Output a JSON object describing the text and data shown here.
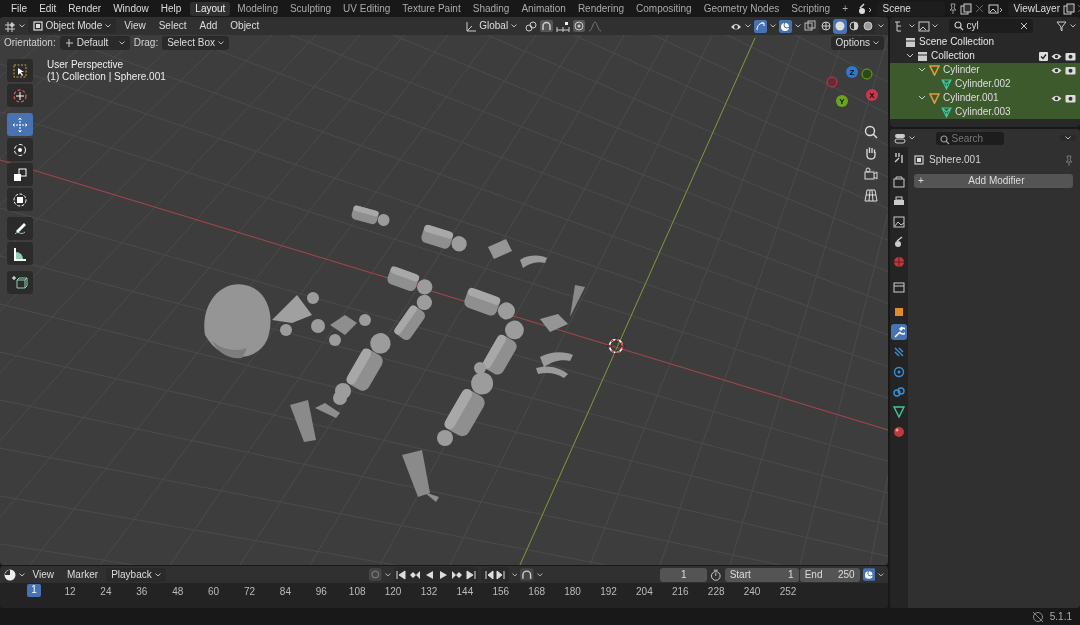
{
  "top_menu": [
    "File",
    "Edit",
    "Render",
    "Window",
    "Help"
  ],
  "workspaces": [
    {
      "label": "Layout",
      "selected": true
    },
    {
      "label": "Modeling",
      "selected": false
    },
    {
      "label": "Sculpting",
      "selected": false
    },
    {
      "label": "UV Editing",
      "selected": false
    },
    {
      "label": "Texture Paint",
      "selected": false
    },
    {
      "label": "Shading",
      "selected": false
    },
    {
      "label": "Animation",
      "selected": false
    },
    {
      "label": "Rendering",
      "selected": false
    },
    {
      "label": "Compositing",
      "selected": false
    },
    {
      "label": "Geometry Nodes",
      "selected": false
    },
    {
      "label": "Scripting",
      "selected": false
    }
  ],
  "add_workspace": "+",
  "scene": "Scene",
  "view_layer": "ViewLayer",
  "viewport": {
    "mode": "Object Mode",
    "menus": [
      "View",
      "Select",
      "Add",
      "Object"
    ],
    "orientation": "Global",
    "shading_modes": [
      {
        "kind": "wireframe",
        "selected": false
      },
      {
        "kind": "solid",
        "selected": true
      },
      {
        "kind": "material",
        "selected": false
      },
      {
        "kind": "rendered",
        "selected": false
      }
    ],
    "tool_settings": {
      "orientation_label": "Orientation:",
      "orientation": "Default",
      "drag_label": "Drag:",
      "drag": "Select Box",
      "options": "Options"
    },
    "info": [
      "User Perspective",
      "(1) Collection | Sphere.001"
    ],
    "tools": [
      {
        "kind": "select",
        "selected": false
      },
      {
        "kind": "cursor",
        "selected": false
      },
      {
        "kind": "move",
        "selected": true
      },
      {
        "kind": "rotate",
        "selected": false
      },
      {
        "kind": "scale",
        "selected": false
      },
      {
        "kind": "transform",
        "selected": false
      },
      {
        "kind": "annotate",
        "selected": false
      },
      {
        "kind": "measure",
        "selected": false
      },
      {
        "kind": "add_cube",
        "selected": false
      }
    ],
    "gizmo_axes": [
      {
        "label": "X",
        "color": "#c8374b"
      },
      {
        "label": "Y",
        "color": "#6ba51c"
      },
      {
        "label": "Z",
        "color": "#2e78d2"
      }
    ]
  },
  "outliner": {
    "search": "cyl",
    "items": [
      {
        "label": "Scene Collection",
        "kind": "scene",
        "children": [
          {
            "label": "Collection",
            "kind": "collection",
            "expanded": true,
            "children": [
              {
                "label": "Cylinder",
                "kind": "object",
                "expanded": true,
                "selected": true,
                "children": [
                  {
                    "label": "Cylinder.002",
                    "kind": "mesh",
                    "selected": true
                  }
                ]
              },
              {
                "label": "Cylinder.001",
                "kind": "object",
                "expanded": true,
                "selected": true,
                "children": [
                  {
                    "label": "Cylinder.003",
                    "kind": "mesh",
                    "selected": true
                  }
                ]
              }
            ]
          }
        ]
      }
    ]
  },
  "properties": {
    "search_placeholder": "Search",
    "object": "Sphere.001",
    "add_modifier": "Add Modifier",
    "add_sign": "+",
    "tabs": [
      {
        "kind": "tool",
        "selected": false
      },
      {
        "kind": "render",
        "selected": false
      },
      {
        "kind": "output",
        "selected": false
      },
      {
        "kind": "view_layer",
        "selected": false
      },
      {
        "kind": "scene",
        "selected": false
      },
      {
        "kind": "world",
        "selected": false
      },
      {
        "kind": "collection",
        "selected": false
      },
      {
        "kind": "object",
        "selected": false
      },
      {
        "kind": "modifiers",
        "selected": true
      },
      {
        "kind": "particles",
        "selected": false
      },
      {
        "kind": "physics",
        "selected": false
      },
      {
        "kind": "constraints",
        "selected": false
      },
      {
        "kind": "data",
        "selected": false
      },
      {
        "kind": "material",
        "selected": false
      }
    ]
  },
  "timeline": {
    "menus": [
      "View",
      "Marker"
    ],
    "playback": "Playback",
    "current_frame": "1",
    "start_label": "Start",
    "start": "1",
    "end_label": "End",
    "end": "250",
    "playhead": "1",
    "ruler": [
      "12",
      "24",
      "36",
      "48",
      "60",
      "72",
      "84",
      "96",
      "108",
      "120",
      "132",
      "144",
      "156",
      "168",
      "180",
      "192",
      "204",
      "216",
      "228",
      "240",
      "252"
    ]
  },
  "status": {
    "version": "5.1.1"
  }
}
